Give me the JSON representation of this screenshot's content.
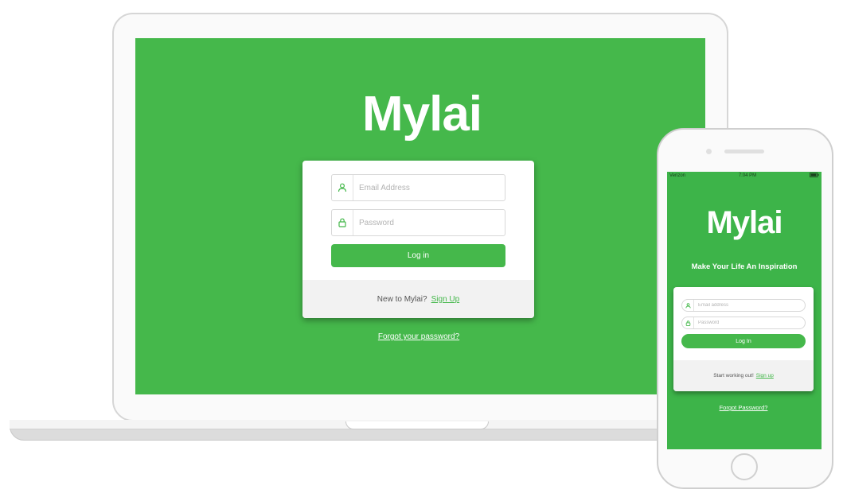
{
  "theme": {
    "brand_green": "#45b84b",
    "phone_green": "#3db449"
  },
  "desktop": {
    "logo_text": "Mylai",
    "email_placeholder": "Email Address",
    "password_placeholder": "Password",
    "login_button": "Log in",
    "signup_prompt": "New to Mylai?",
    "signup_link": "Sign Up",
    "forgot_link": "Forgot your password?",
    "icons": {
      "email": "user-icon",
      "password": "lock-icon"
    }
  },
  "mobile": {
    "status_bar": {
      "carrier": "Verizon",
      "time": "7:04 PM"
    },
    "logo_text": "Mylai",
    "tagline": "Make Your Life An Inspiration",
    "email_placeholder": "Email address",
    "password_placeholder": "Password",
    "login_button": "Log In",
    "signup_prompt": "Start working out!",
    "signup_link": "Sign up",
    "forgot_link": "Forgot Password?",
    "icons": {
      "email": "user-icon",
      "password": "lock-icon"
    }
  }
}
